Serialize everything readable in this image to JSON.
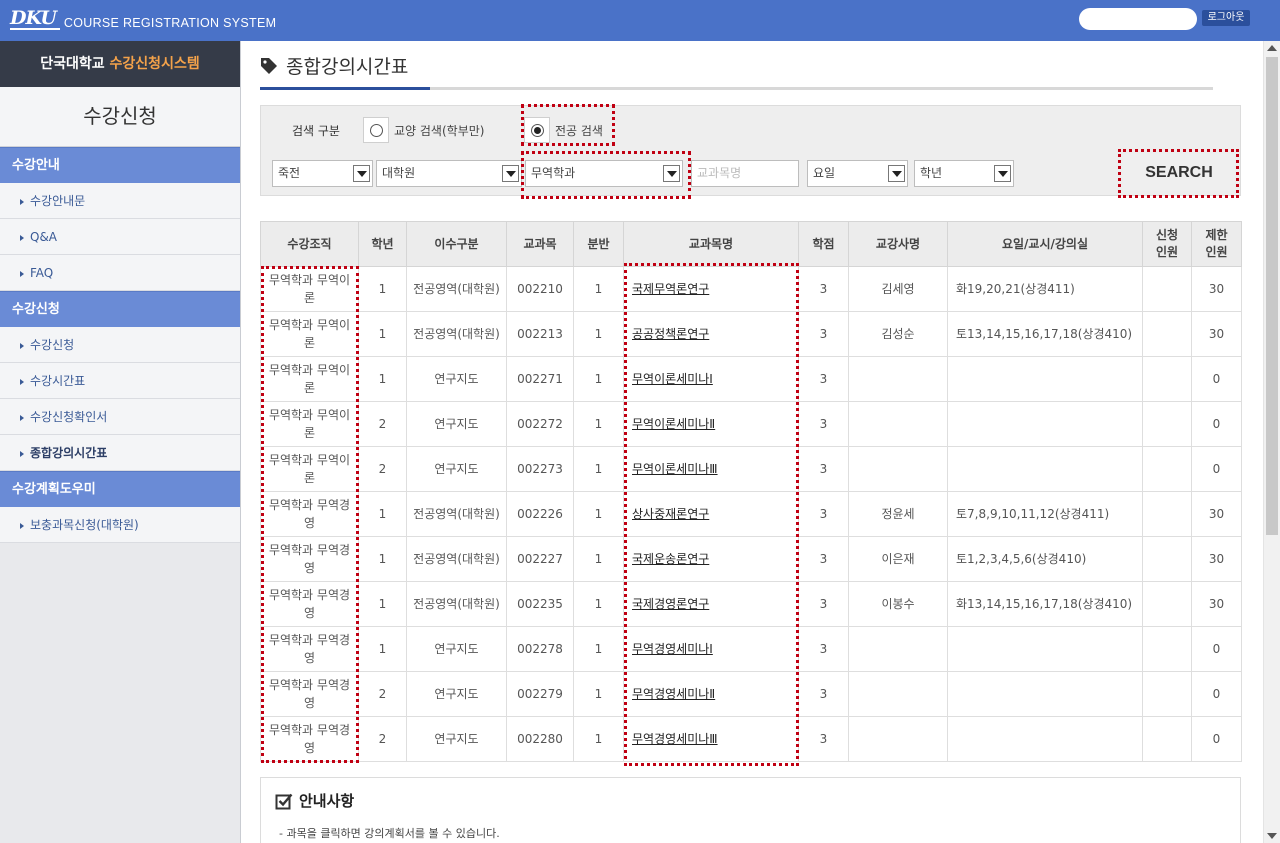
{
  "header": {
    "logo_mark": "DKU",
    "logo_text": "COURSE REGISTRATION SYSTEM",
    "logout_label": "로그아웃"
  },
  "sidebar": {
    "brand_prefix": "단국대학교 ",
    "brand_highlight": "수강신청시스템",
    "title": "수강신청",
    "groups": [
      {
        "label": "수강안내",
        "items": [
          {
            "label": "수강안내문"
          },
          {
            "label": "Q&A"
          },
          {
            "label": "FAQ"
          }
        ]
      },
      {
        "label": "수강신청",
        "items": [
          {
            "label": "수강신청"
          },
          {
            "label": "수강시간표"
          },
          {
            "label": "수강신청확인서"
          },
          {
            "label": "종합강의시간표"
          }
        ]
      },
      {
        "label": "수강계획도우미",
        "items": [
          {
            "label": "보충과목신청(대학원)"
          }
        ]
      }
    ]
  },
  "main": {
    "title": "종합강의시간표"
  },
  "search": {
    "label": "검색 구분",
    "radio_liberal": "교양 검색(학부만)",
    "radio_major": "전공 검색",
    "campus": "죽전",
    "college": "대학원",
    "department": "무역학과",
    "course_name_placeholder": "교과목명",
    "day": "요일",
    "grade": "학년",
    "button": "SEARCH"
  },
  "table": {
    "headers": [
      "수강조직",
      "학년",
      "이수구분",
      "교과목",
      "분반",
      "교과목명",
      "학점",
      "교강사명",
      "요일/교시/강의실",
      "신청\n인원",
      "제한\n인원"
    ],
    "rows": [
      {
        "org": "무역학과 무역이론",
        "grade": "1",
        "type": "전공영역(대학원)",
        "code": "002210",
        "sec": "1",
        "name": "국제무역론연구",
        "credit": "3",
        "prof": "김세영",
        "time": "화19,20,21(상경411)",
        "applied": "",
        "limit": "30"
      },
      {
        "org": "무역학과 무역이론",
        "grade": "1",
        "type": "전공영역(대학원)",
        "code": "002213",
        "sec": "1",
        "name": "공공정책론연구",
        "credit": "3",
        "prof": "김성순",
        "time": "토13,14,15,16,17,18(상경410)",
        "applied": "",
        "limit": "30"
      },
      {
        "org": "무역학과 무역이론",
        "grade": "1",
        "type": "연구지도",
        "code": "002271",
        "sec": "1",
        "name": "무역이론세미나Ⅰ",
        "credit": "3",
        "prof": "",
        "time": "",
        "applied": "",
        "limit": "0"
      },
      {
        "org": "무역학과 무역이론",
        "grade": "2",
        "type": "연구지도",
        "code": "002272",
        "sec": "1",
        "name": "무역이론세미나Ⅱ",
        "credit": "3",
        "prof": "",
        "time": "",
        "applied": "",
        "limit": "0"
      },
      {
        "org": "무역학과 무역이론",
        "grade": "2",
        "type": "연구지도",
        "code": "002273",
        "sec": "1",
        "name": "무역이론세미나Ⅲ",
        "credit": "3",
        "prof": "",
        "time": "",
        "applied": "",
        "limit": "0"
      },
      {
        "org": "무역학과 무역경영",
        "grade": "1",
        "type": "전공영역(대학원)",
        "code": "002226",
        "sec": "1",
        "name": "상사중재론연구",
        "credit": "3",
        "prof": "정윤세",
        "time": "토7,8,9,10,11,12(상경411)",
        "applied": "",
        "limit": "30"
      },
      {
        "org": "무역학과 무역경영",
        "grade": "1",
        "type": "전공영역(대학원)",
        "code": "002227",
        "sec": "1",
        "name": "국제운송론연구",
        "credit": "3",
        "prof": "이은재",
        "time": "토1,2,3,4,5,6(상경410)",
        "applied": "",
        "limit": "30"
      },
      {
        "org": "무역학과 무역경영",
        "grade": "1",
        "type": "전공영역(대학원)",
        "code": "002235",
        "sec": "1",
        "name": "국제경영론연구",
        "credit": "3",
        "prof": "이봉수",
        "time": "화13,14,15,16,17,18(상경410)",
        "applied": "",
        "limit": "30"
      },
      {
        "org": "무역학과 무역경영",
        "grade": "1",
        "type": "연구지도",
        "code": "002278",
        "sec": "1",
        "name": "무역경영세미나Ⅰ",
        "credit": "3",
        "prof": "",
        "time": "",
        "applied": "",
        "limit": "0"
      },
      {
        "org": "무역학과 무역경영",
        "grade": "2",
        "type": "연구지도",
        "code": "002279",
        "sec": "1",
        "name": "무역경영세미나Ⅱ",
        "credit": "3",
        "prof": "",
        "time": "",
        "applied": "",
        "limit": "0"
      },
      {
        "org": "무역학과 무역경영",
        "grade": "2",
        "type": "연구지도",
        "code": "002280",
        "sec": "1",
        "name": "무역경영세미나Ⅲ",
        "credit": "3",
        "prof": "",
        "time": "",
        "applied": "",
        "limit": "0"
      }
    ]
  },
  "notice": {
    "title": "안내사항",
    "lines": [
      "-  과목을 클릭하면 강의계획서를 볼 수 있습니다."
    ]
  }
}
